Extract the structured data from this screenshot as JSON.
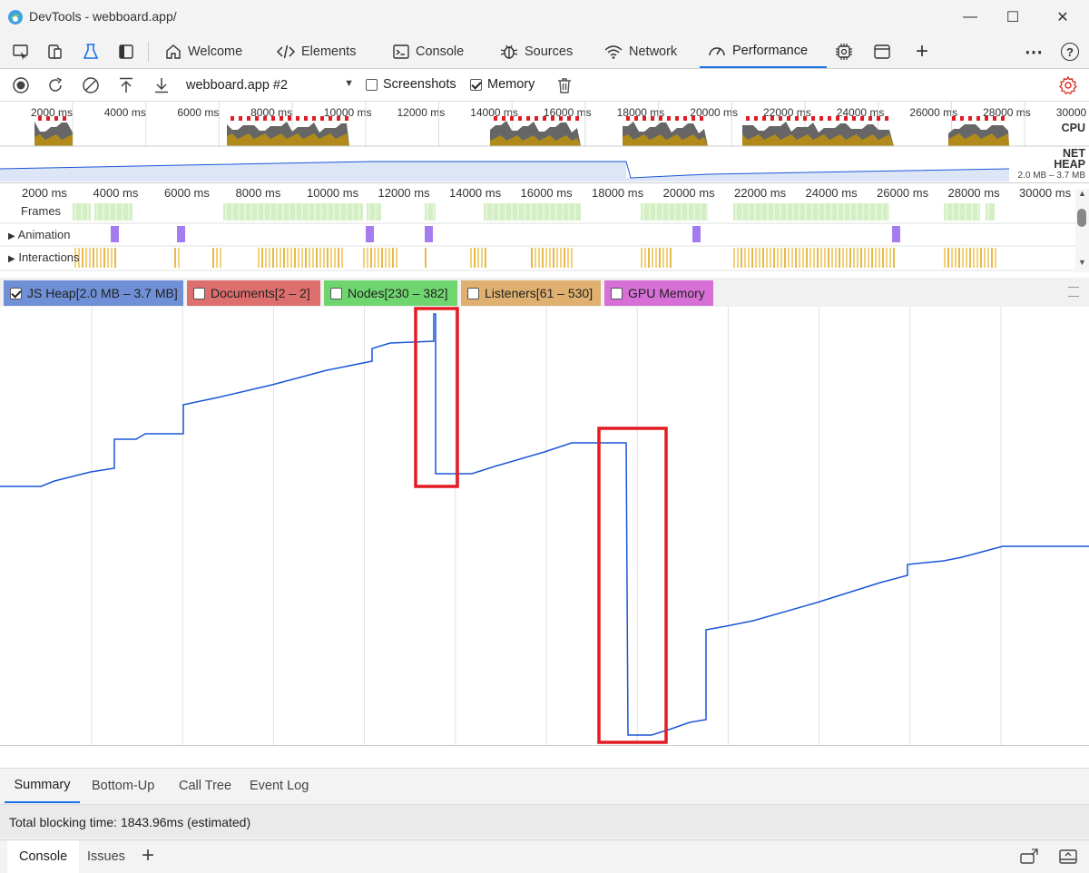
{
  "window": {
    "title": "DevTools - webboard.app/",
    "minimize_glyph": "—",
    "maximize_glyph": "☐",
    "close_glyph": "✕"
  },
  "tabs": [
    {
      "label": "Welcome",
      "icon": "home-icon"
    },
    {
      "label": "Elements",
      "icon": "code-icon"
    },
    {
      "label": "Console",
      "icon": "console-icon"
    },
    {
      "label": "Sources",
      "icon": "bug-icon"
    },
    {
      "label": "Network",
      "icon": "wifi-icon"
    },
    {
      "label": "Performance",
      "icon": "gauge-icon",
      "active": true
    }
  ],
  "tabbar_more": {
    "more": "⋯",
    "help": "?",
    "add": "+"
  },
  "toolbar": {
    "profile": "webboard.app #2",
    "screenshots_label": "Screenshots",
    "screenshots_checked": false,
    "memory_label": "Memory",
    "memory_checked": true
  },
  "overview": {
    "ticks": [
      "2000 ms",
      "4000 ms",
      "6000 ms",
      "8000 ms",
      "10000 ms",
      "12000 ms",
      "14000 ms",
      "16000 ms",
      "18000 ms",
      "20000 ms",
      "22000 ms",
      "24000 ms",
      "26000 ms",
      "28000 ms",
      "30000 ms"
    ],
    "cpu_label": "CPU",
    "net_label": "NET",
    "heap_label": "HEAP",
    "heap_range": "2.0 MB – 3.7 MB"
  },
  "tracks": {
    "ticks": [
      "2000 ms",
      "4000 ms",
      "6000 ms",
      "8000 ms",
      "10000 ms",
      "12000 ms",
      "14000 ms",
      "16000 ms",
      "18000 ms",
      "20000 ms",
      "22000 ms",
      "24000 ms",
      "26000 ms",
      "28000 ms",
      "30000 ms"
    ],
    "frames_label": "Frames",
    "animation_label": "Animation",
    "interactions_label": "Interactions"
  },
  "counters": [
    {
      "label": "JS Heap[2.0 MB – 3.7 MB]",
      "checked": true,
      "color": "#6f8fd6"
    },
    {
      "label": "Documents[2 – 2]",
      "checked": false,
      "color": "#de6f6f"
    },
    {
      "label": "Nodes[230 – 382]",
      "checked": false,
      "color": "#6fd66f"
    },
    {
      "label": "Listeners[61 – 530]",
      "checked": false,
      "color": "#dfb06f"
    },
    {
      "label": "GPU Memory",
      "checked": false,
      "color": "#d66fd6"
    }
  ],
  "graph": {
    "line_color": "#1a56d6",
    "highlight_color": "#e31b23"
  },
  "bottom_tabs": [
    {
      "label": "Summary",
      "active": true
    },
    {
      "label": "Bottom-Up"
    },
    {
      "label": "Call Tree"
    },
    {
      "label": "Event Log"
    }
  ],
  "summary": {
    "text": "Total blocking time: 1843.96ms (estimated)"
  },
  "drawer": {
    "tabs": [
      "Console",
      "Issues"
    ],
    "add": "+"
  }
}
